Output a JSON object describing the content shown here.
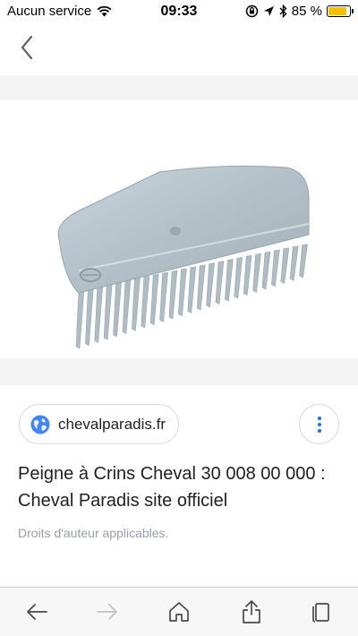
{
  "status_bar": {
    "carrier": "Aucun service",
    "time": "09:33",
    "battery": "85 %",
    "battery_level": 0.85
  },
  "result": {
    "source": "chevalparadis.fr",
    "title": "Peigne à Crins Cheval 30 008 00 000 : Cheval Paradis site officiel",
    "copyright": "Droits d'auteur applicables."
  },
  "icons": {
    "back": "chevron-left-icon",
    "source": "globe-icon",
    "more": "vertical-dots-icon",
    "toolbar": [
      "arrow-left-icon",
      "arrow-right-icon",
      "home-icon",
      "share-icon",
      "tabs-icon"
    ]
  },
  "colors": {
    "accent": "#1a73e8",
    "battery": "#f6c000"
  }
}
